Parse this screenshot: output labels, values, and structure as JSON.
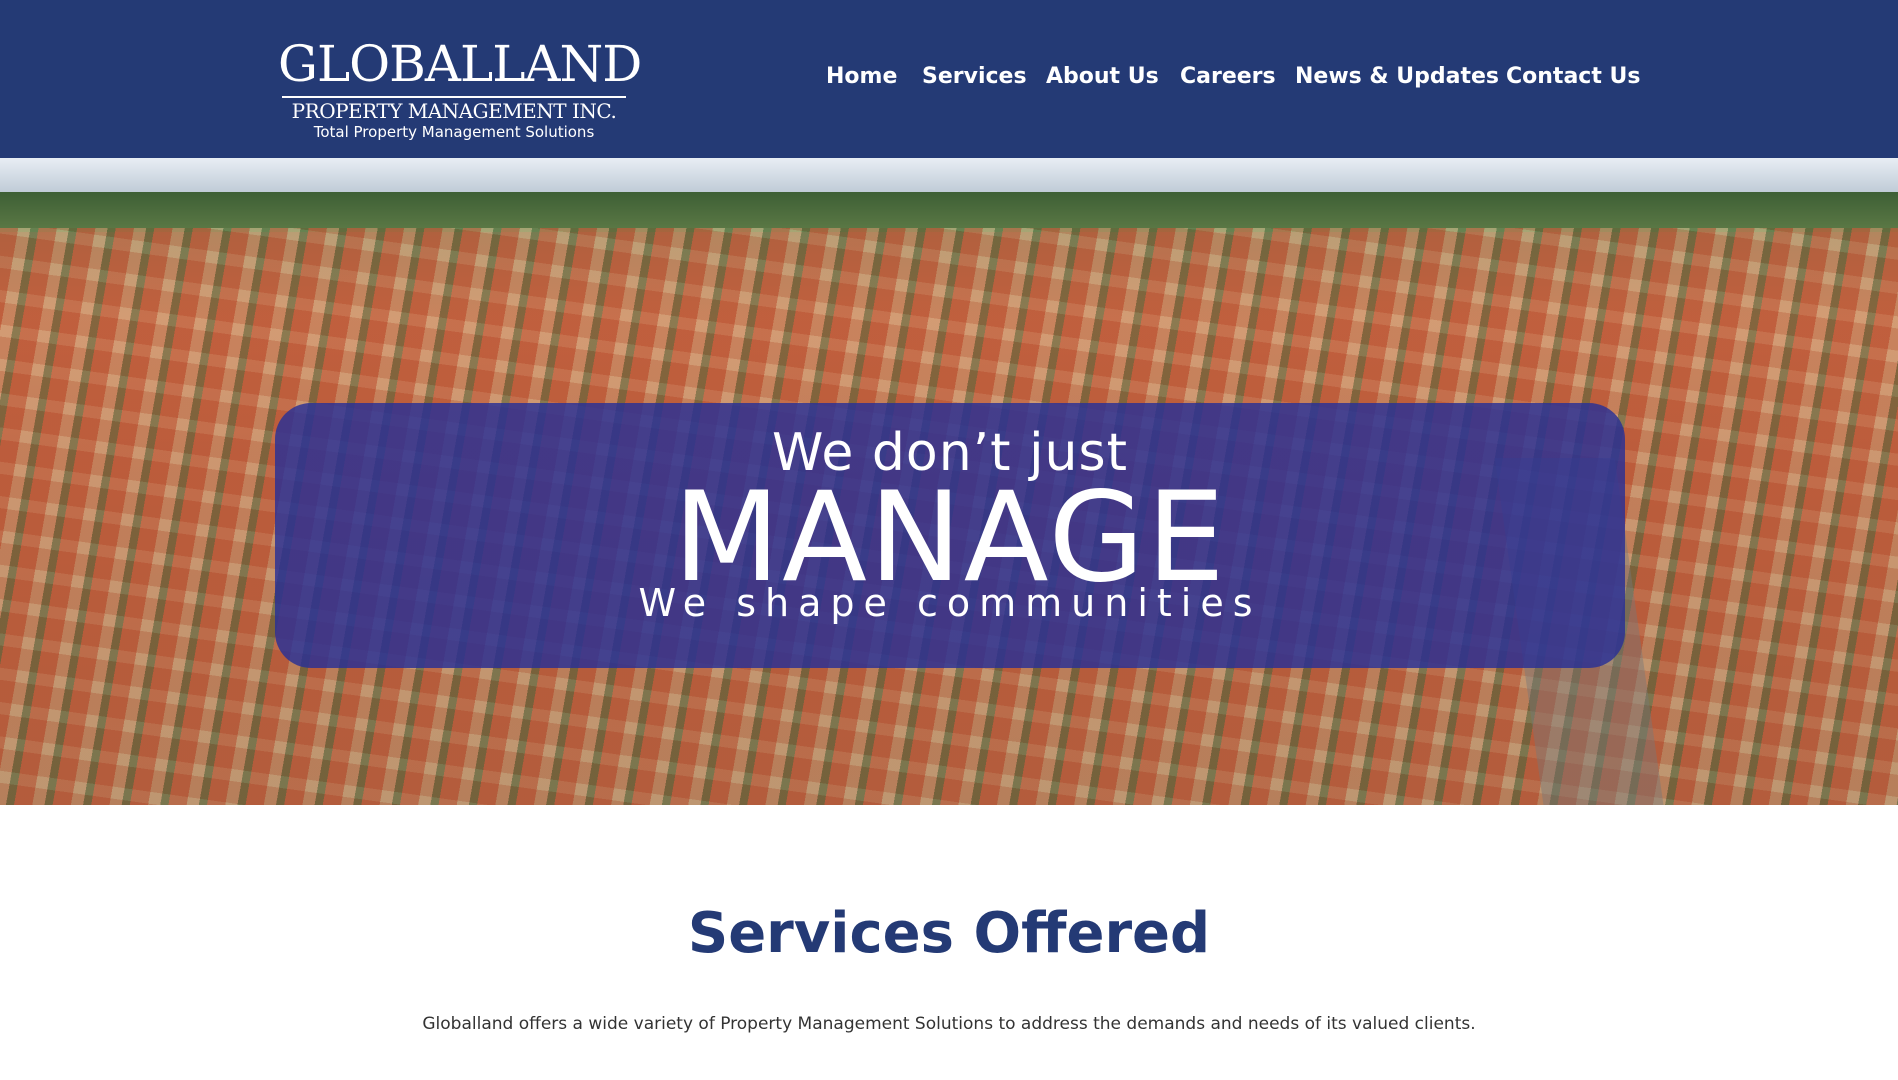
{
  "logo": {
    "main": "GLOBALLAND",
    "sub": "PROPERTY MANAGEMENT INC.",
    "tagline": "Total Property Management Solutions"
  },
  "nav": {
    "items": [
      {
        "label": "Home"
      },
      {
        "label": "Services"
      },
      {
        "label": "About Us"
      },
      {
        "label": "Careers"
      },
      {
        "label": "News & Updates"
      },
      {
        "label": "Contact Us"
      }
    ]
  },
  "hero": {
    "line1": "We don’t just",
    "line2": "MANAGE",
    "line3": "We shape communities"
  },
  "services": {
    "title": "Services Offered",
    "description": "Globalland offers a wide variety of Property Management Solutions to address the demands and needs of its valued clients."
  },
  "colors": {
    "header_bg": "#243a75",
    "hero_panel": "#2830a0",
    "title": "#243a75"
  }
}
